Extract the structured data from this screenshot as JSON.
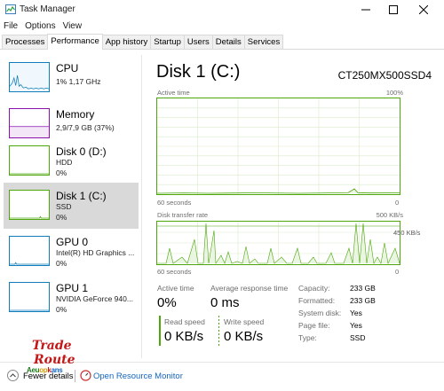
{
  "window": {
    "title": "Task Manager"
  },
  "menu": {
    "file": "File",
    "options": "Options",
    "view": "View"
  },
  "tabs": [
    "Processes",
    "Performance",
    "App history",
    "Startup",
    "Users",
    "Details",
    "Services"
  ],
  "sidebar": {
    "items": [
      {
        "title": "CPU",
        "line1": "1%  1,17 GHz",
        "line2": "",
        "color": "#117dbb"
      },
      {
        "title": "Memory",
        "line1": "2,9/7,9 GB (37%)",
        "line2": "",
        "color": "#8b12ae"
      },
      {
        "title": "Disk 0 (D:)",
        "line1": "HDD",
        "line2": "0%",
        "color": "#4da60c"
      },
      {
        "title": "Disk 1 (C:)",
        "line1": "SSD",
        "line2": "0%",
        "color": "#4da60c"
      },
      {
        "title": "GPU 0",
        "line1": "Intel(R) HD Graphics ...",
        "line2": "0%",
        "color": "#117dbb"
      },
      {
        "title": "GPU 1",
        "line1": "NVIDIA GeForce 940...",
        "line2": "0%",
        "color": "#117dbb"
      }
    ]
  },
  "main": {
    "title": "Disk 1 (C:)",
    "model": "CT250MX500SSD4",
    "active_time_label": "Active time",
    "active_time_max": "100%",
    "graph1_xlabel": "60 seconds",
    "graph1_xmin": "0",
    "transfer_label": "Disk transfer rate",
    "transfer_max": "500 KB/s",
    "transfer_inner": "450 KB/s",
    "graph2_xlabel": "60 seconds",
    "graph2_xmin": "0"
  },
  "stats": {
    "active_time_label": "Active time",
    "active_time_value": "0%",
    "resp_label": "Average response time",
    "resp_value": "0 ms",
    "read_label": "Read speed",
    "read_value": "0 KB/s",
    "write_label": "Write speed",
    "write_value": "0 KB/s"
  },
  "props": [
    {
      "key": "Capacity:",
      "value": "233 GB"
    },
    {
      "key": "Formatted:",
      "value": "233 GB"
    },
    {
      "key": "System disk:",
      "value": "Yes"
    },
    {
      "key": "Page file:",
      "value": "Yes"
    },
    {
      "key": "Type:",
      "value": "SSD"
    }
  ],
  "bottom": {
    "fewer": "Fewer details",
    "orm": "Open Resource Monitor"
  },
  "watermark": {
    "line1": "Trade",
    "line2": "Route",
    "band": "Aeuopkans"
  },
  "colors": {
    "disk": "#4da60c",
    "cpu": "#117dbb",
    "memory": "#8b12ae",
    "link": "#1565c0"
  }
}
